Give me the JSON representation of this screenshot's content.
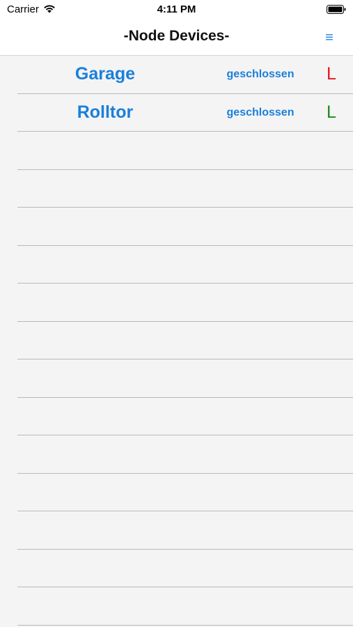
{
  "status_bar": {
    "carrier": "Carrier",
    "time": "4:11 PM"
  },
  "nav": {
    "title": "-Node Devices-",
    "menu_icon": "≡"
  },
  "colors": {
    "accent": "#1a7fdc",
    "indicator_red": "#e8141e",
    "indicator_green": "#1b8a1b"
  },
  "devices": [
    {
      "name": "Garage",
      "state": "geschlossen",
      "indicator": "L",
      "indicator_color": "#e8141e"
    },
    {
      "name": "Rolltor",
      "state": "geschlossen",
      "indicator": "L",
      "indicator_color": "#1b8a1b"
    }
  ],
  "empty_rows": 13
}
